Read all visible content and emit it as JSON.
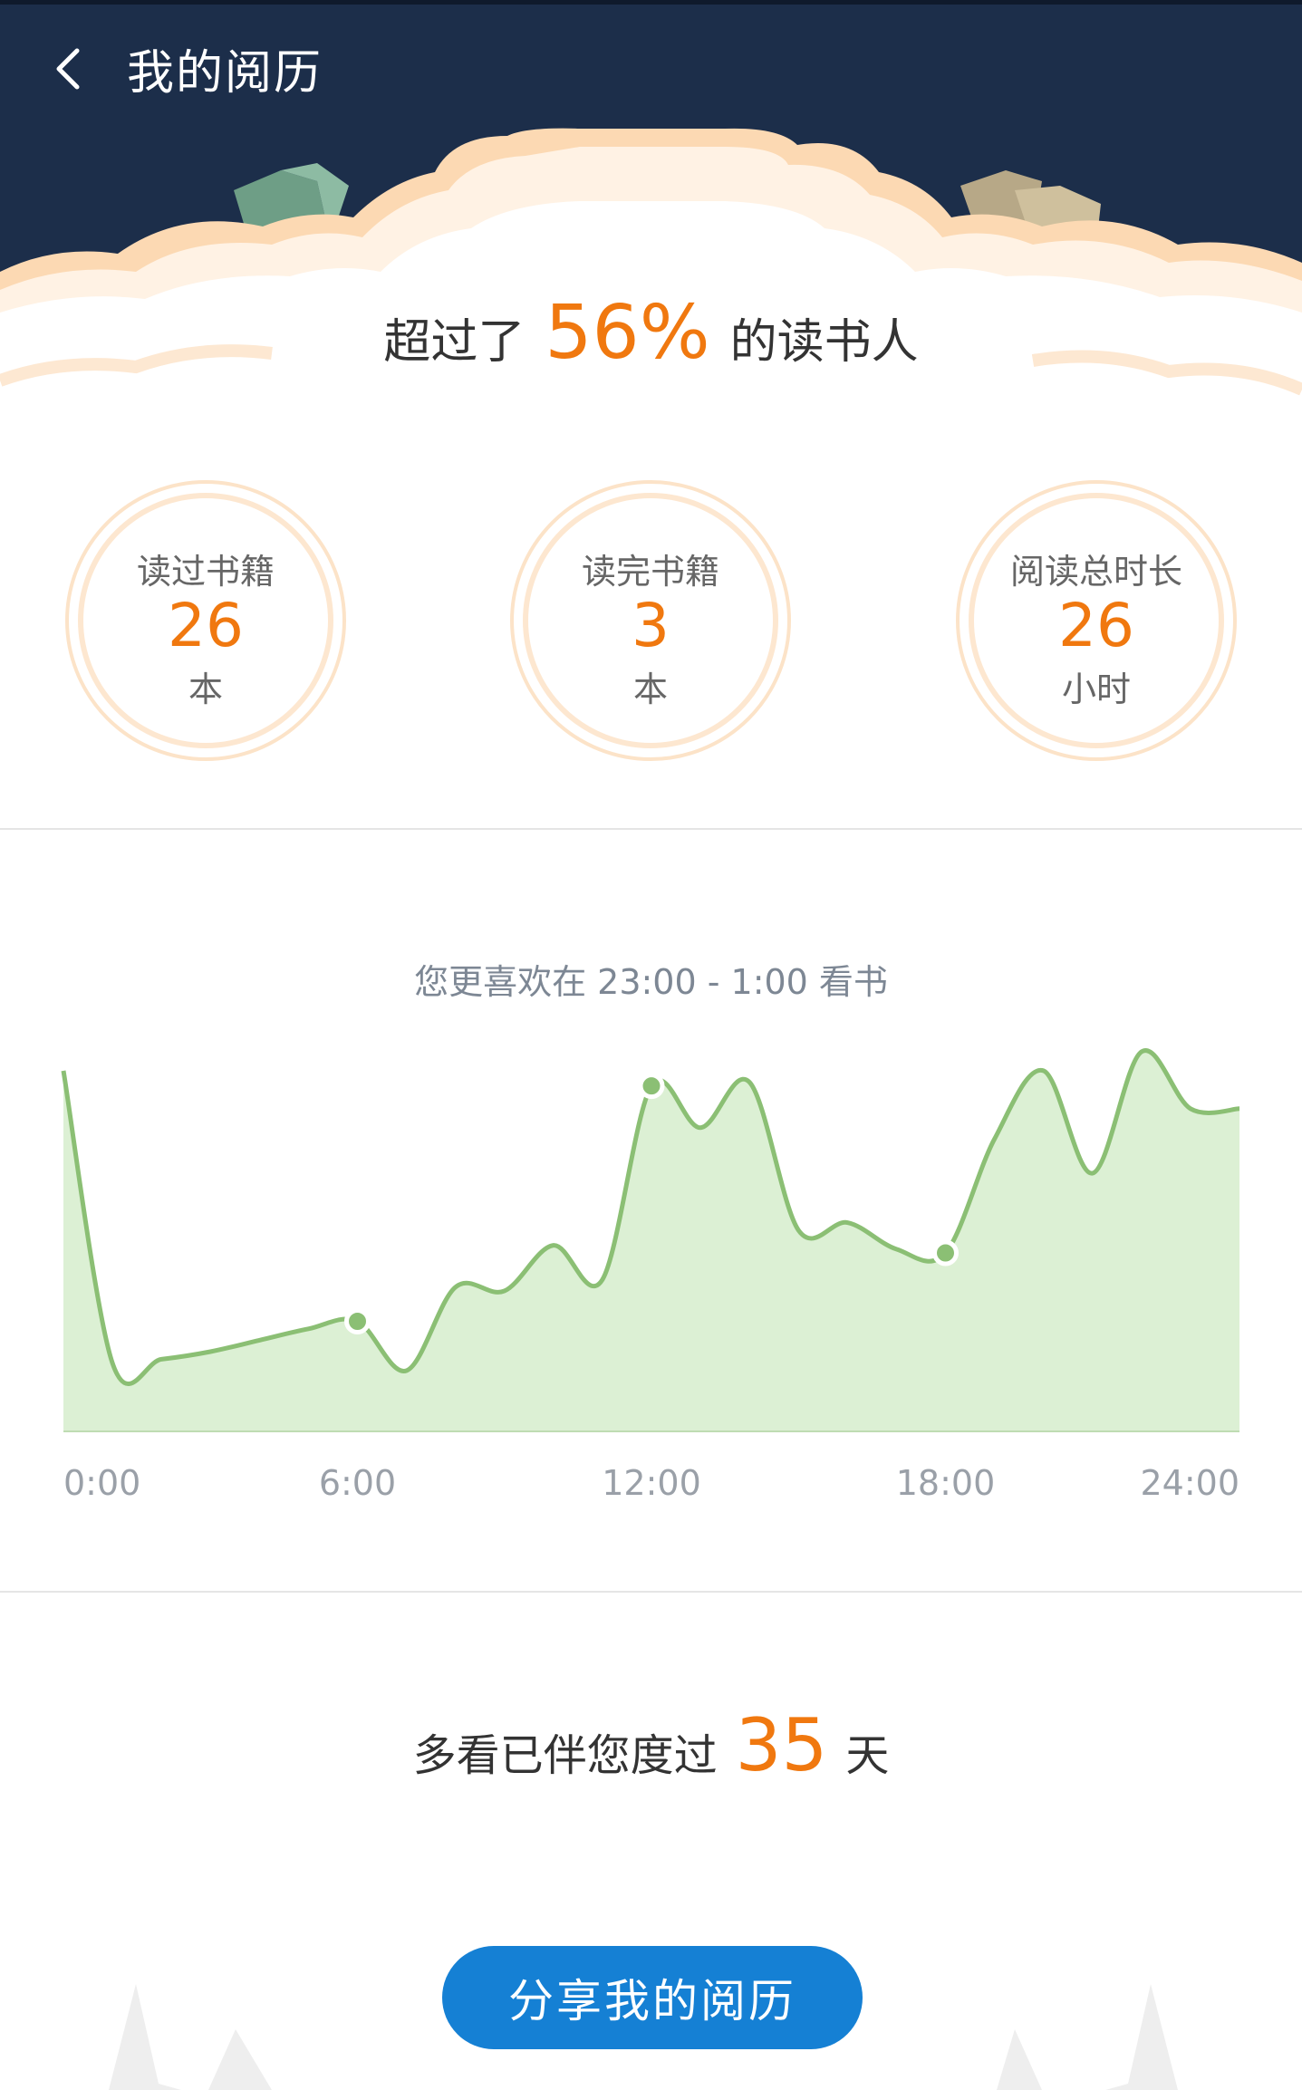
{
  "header": {
    "title": "我的阅历",
    "back_icon": "chevron-left-icon",
    "background": "#1c2e4a"
  },
  "rank": {
    "prefix": "超过了",
    "percent": "56%",
    "suffix": "的读书人"
  },
  "stats": [
    {
      "label": "读过书籍",
      "value": "26",
      "unit": "本"
    },
    {
      "label": "读完书籍",
      "value": "3",
      "unit": "本"
    },
    {
      "label": "阅读总时长",
      "value": "26",
      "unit": "小时"
    }
  ],
  "chart_data": {
    "type": "area",
    "title": "您更喜欢在 23:00 - 1:00 看书",
    "x_ticks": [
      "0:00",
      "6:00",
      "12:00",
      "18:00",
      "24:00"
    ],
    "x": [
      0,
      1,
      2,
      3,
      4,
      5,
      6,
      7,
      8,
      9,
      10,
      11,
      12,
      13,
      14,
      15,
      16,
      17,
      18,
      19,
      20,
      21,
      22,
      23,
      24
    ],
    "values": [
      95,
      18,
      19,
      21,
      24,
      27,
      29,
      16,
      38,
      37,
      49,
      40,
      91,
      80,
      92,
      53,
      55,
      48,
      47,
      77,
      95,
      68,
      100,
      85,
      85
    ],
    "marked_points_x": [
      6,
      12,
      18
    ],
    "ylim": [
      0,
      105
    ],
    "line_color": "#8bbf74",
    "fill_color": "#dcf0d4"
  },
  "days": {
    "prefix": "多看已伴您度过",
    "value": "35",
    "suffix": "天"
  },
  "share_button": {
    "label": "分享我的阅历"
  },
  "accent_color": "#f0780f"
}
